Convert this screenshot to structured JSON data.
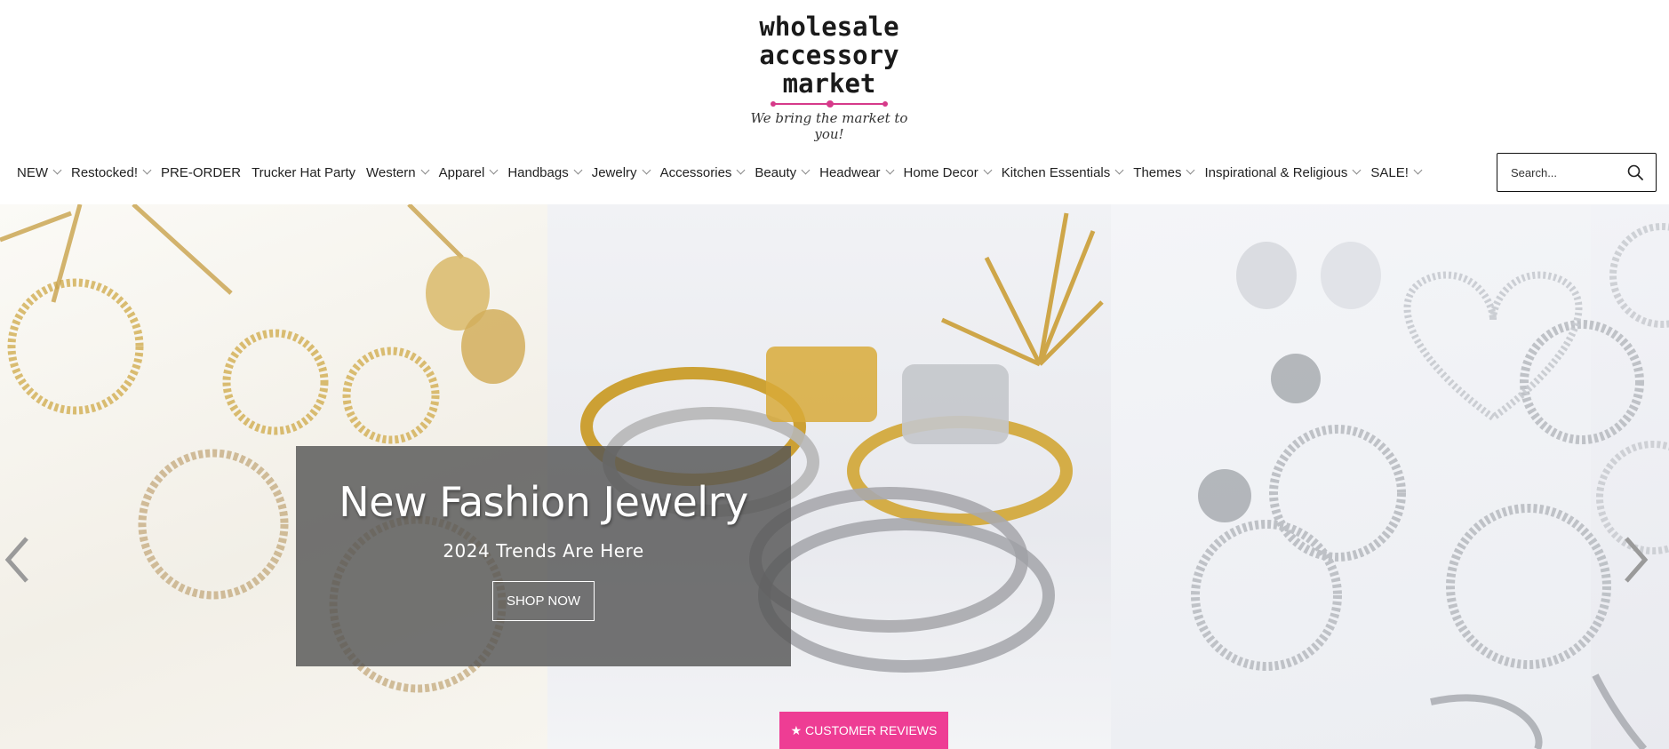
{
  "logo": {
    "lines": [
      "wholesale",
      "accessory",
      "market"
    ],
    "tagline": "We bring the market to you!",
    "accent_color": "#d63a8a"
  },
  "nav": {
    "items": [
      {
        "label": "NEW",
        "dropdown": true
      },
      {
        "label": "Restocked!",
        "dropdown": true
      },
      {
        "label": "PRE-ORDER",
        "dropdown": false
      },
      {
        "label": "Trucker Hat Party",
        "dropdown": false
      },
      {
        "label": "Western",
        "dropdown": true
      },
      {
        "label": "Apparel",
        "dropdown": true
      },
      {
        "label": "Handbags",
        "dropdown": true
      },
      {
        "label": "Jewelry",
        "dropdown": true
      },
      {
        "label": "Accessories",
        "dropdown": true
      },
      {
        "label": "Beauty",
        "dropdown": true
      },
      {
        "label": "Headwear",
        "dropdown": true
      },
      {
        "label": "Home Decor",
        "dropdown": true
      },
      {
        "label": "Kitchen Essentials",
        "dropdown": true
      },
      {
        "label": "Themes",
        "dropdown": true
      },
      {
        "label": "Inspirational & Religious",
        "dropdown": true
      },
      {
        "label": "SALE!",
        "dropdown": true
      }
    ]
  },
  "search": {
    "placeholder": "Search...",
    "icon": "search-icon"
  },
  "hero": {
    "title": "New Fashion Jewelry",
    "subtitle": "2024 Trends Are Here",
    "cta_label": "SHOP NOW",
    "prev_icon": "chevron-left-icon",
    "next_icon": "chevron-right-icon"
  },
  "reviews_button": {
    "label": "★ CUSTOMER REVIEWS",
    "color": "#ee3d94"
  }
}
